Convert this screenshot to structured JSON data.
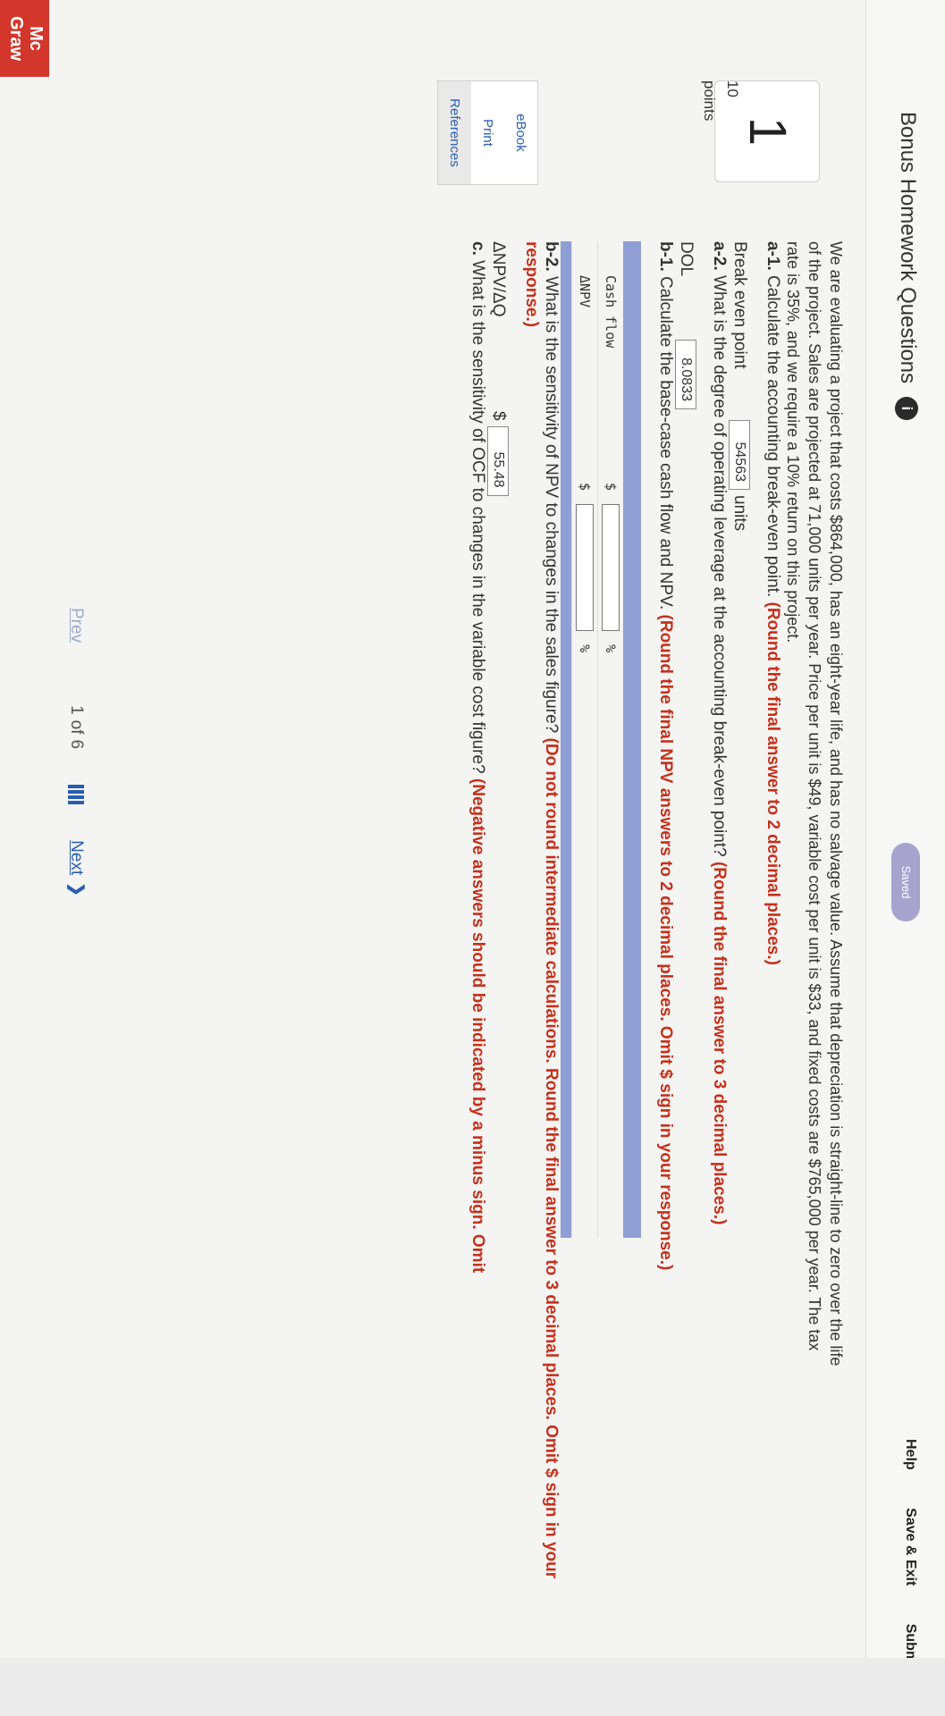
{
  "header": {
    "title": "Bonus Homework Questions",
    "info_badge": "i",
    "status": "Saved",
    "help": "Help",
    "save_exit": "Save & Exit",
    "submit": "Submit"
  },
  "question": {
    "number": "1",
    "points_value": "10",
    "points_label": "points",
    "statement": "We are evaluating a project that costs $864,000, has an eight-year life, and has no salvage value. Assume that depreciation is straight-line to zero over the life of the project. Sales are projected at 71,000 units per year. Price per unit is $49, variable cost per unit is $33, and fixed costs are $765,000 per year. The tax rate is 35%, and we require a 10% return on this project."
  },
  "sidebar": {
    "ebook": "eBook",
    "print": "Print",
    "references": "References"
  },
  "parts": {
    "a1": {
      "tag": "a-1.",
      "text": "Calculate the accounting break-even point.",
      "instruction": "(Round the final answer to 2 decimal places.)",
      "row_label": "Break even point",
      "value": "54563",
      "unit": "units"
    },
    "a2": {
      "tag": "a-2.",
      "text": "What is the degree of operating leverage at the accounting break-even point?",
      "instruction": "(Round the final answer to 3 decimal places.)",
      "row_label": "DOL",
      "value": "8.0833"
    },
    "b1": {
      "tag": "b-1.",
      "text": "Calculate the base-case cash flow and NPV.",
      "instruction": "(Round the final NPV answers to 2 decimal places. Omit $ sign in your response.)",
      "rows": [
        {
          "label": "Cash flow",
          "sign": "$",
          "suffix": "%",
          "value": ""
        },
        {
          "label": "ΔNPV",
          "sign": "$",
          "suffix": "%",
          "value": ""
        }
      ]
    },
    "b2": {
      "tag": "b-2.",
      "text": "What is the sensitivity of NPV to changes in the sales figure?",
      "instruction": "(Do not round intermediate calculations. Round the final answer to 3 decimal places. Omit $ sign in your response.)",
      "row_label": "ΔNPV/ΔQ",
      "sign": "$",
      "value": "55.48"
    },
    "c": {
      "tag": "c.",
      "text": "What is the sensitivity of OCF to changes in the variable cost figure?",
      "instruction": "(Negative answers should be indicated by a minus sign. Omit"
    }
  },
  "pager": {
    "prev": "Prev",
    "current": "1",
    "of": "of",
    "total": "6",
    "next": "Next"
  },
  "logo": {
    "line1": "Mc",
    "line2": "Graw"
  },
  "colors": {
    "accent": "#2a5db0",
    "instruction_red": "#c5311c",
    "table_header": "#8f9fd3",
    "saved_badge": "#a7a3cf",
    "logo": "#d3362b"
  }
}
